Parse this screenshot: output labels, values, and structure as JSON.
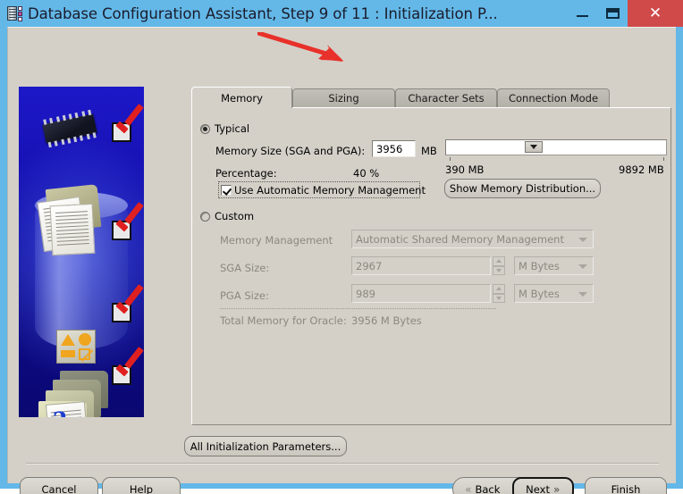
{
  "window": {
    "title": "Database Configuration Assistant, Step 9 of 11 : Initialization P...",
    "app_icon": "memory-chip-icon",
    "controls": {
      "minimize": "minimize-icon",
      "maximize": "restore-icon",
      "close": "✕"
    },
    "titlebar_color": "#63b8e8",
    "close_color": "#d04a4a"
  },
  "annotation": {
    "arrow": "red-arrow-pointing-to-sizing-tab",
    "color": "#e8312a"
  },
  "side_graphic": {
    "alt": "oracle-database-steps-illustration",
    "background_color": "#120ea8",
    "check_color": "#e02020",
    "steps_completed": 4
  },
  "tabs": [
    {
      "label": "Memory",
      "active": true
    },
    {
      "label": "Sizing",
      "active": false
    },
    {
      "label": "Character Sets",
      "active": false
    },
    {
      "label": "Connection Mode",
      "active": false
    }
  ],
  "typical": {
    "radio_label": "Typical",
    "selected": true,
    "memory_size_label": "Memory Size (SGA and PGA):",
    "memory_size_value": "3956",
    "memory_size_unit": "MB",
    "percentage_label": "Percentage:",
    "percentage_value": "40 %",
    "slider": {
      "min_label": "390 MB",
      "max_label": "9892 MB",
      "value_percent": 40
    },
    "auto_memory_label": "Use Automatic Memory Management",
    "auto_memory_checked": true,
    "show_distribution_button": "Show Memory Distribution..."
  },
  "custom": {
    "radio_label": "Custom",
    "selected": false,
    "memory_management_label": "Memory Management",
    "memory_management_value": "Automatic Shared Memory Management",
    "sga_label": "SGA Size:",
    "sga_value": "2967",
    "sga_unit": "M Bytes",
    "pga_label": "PGA Size:",
    "pga_value": "989",
    "pga_unit": "M Bytes",
    "total_label": "Total Memory for Oracle:",
    "total_value": "3956 M Bytes"
  },
  "footer": {
    "all_params_button": "All Initialization Parameters...",
    "cancel_button": "Cancel",
    "help_button": "Help",
    "back_button": "Back",
    "next_button": "Next",
    "finish_button": "Finish",
    "back_chevron": "«",
    "next_chevron": "»"
  }
}
